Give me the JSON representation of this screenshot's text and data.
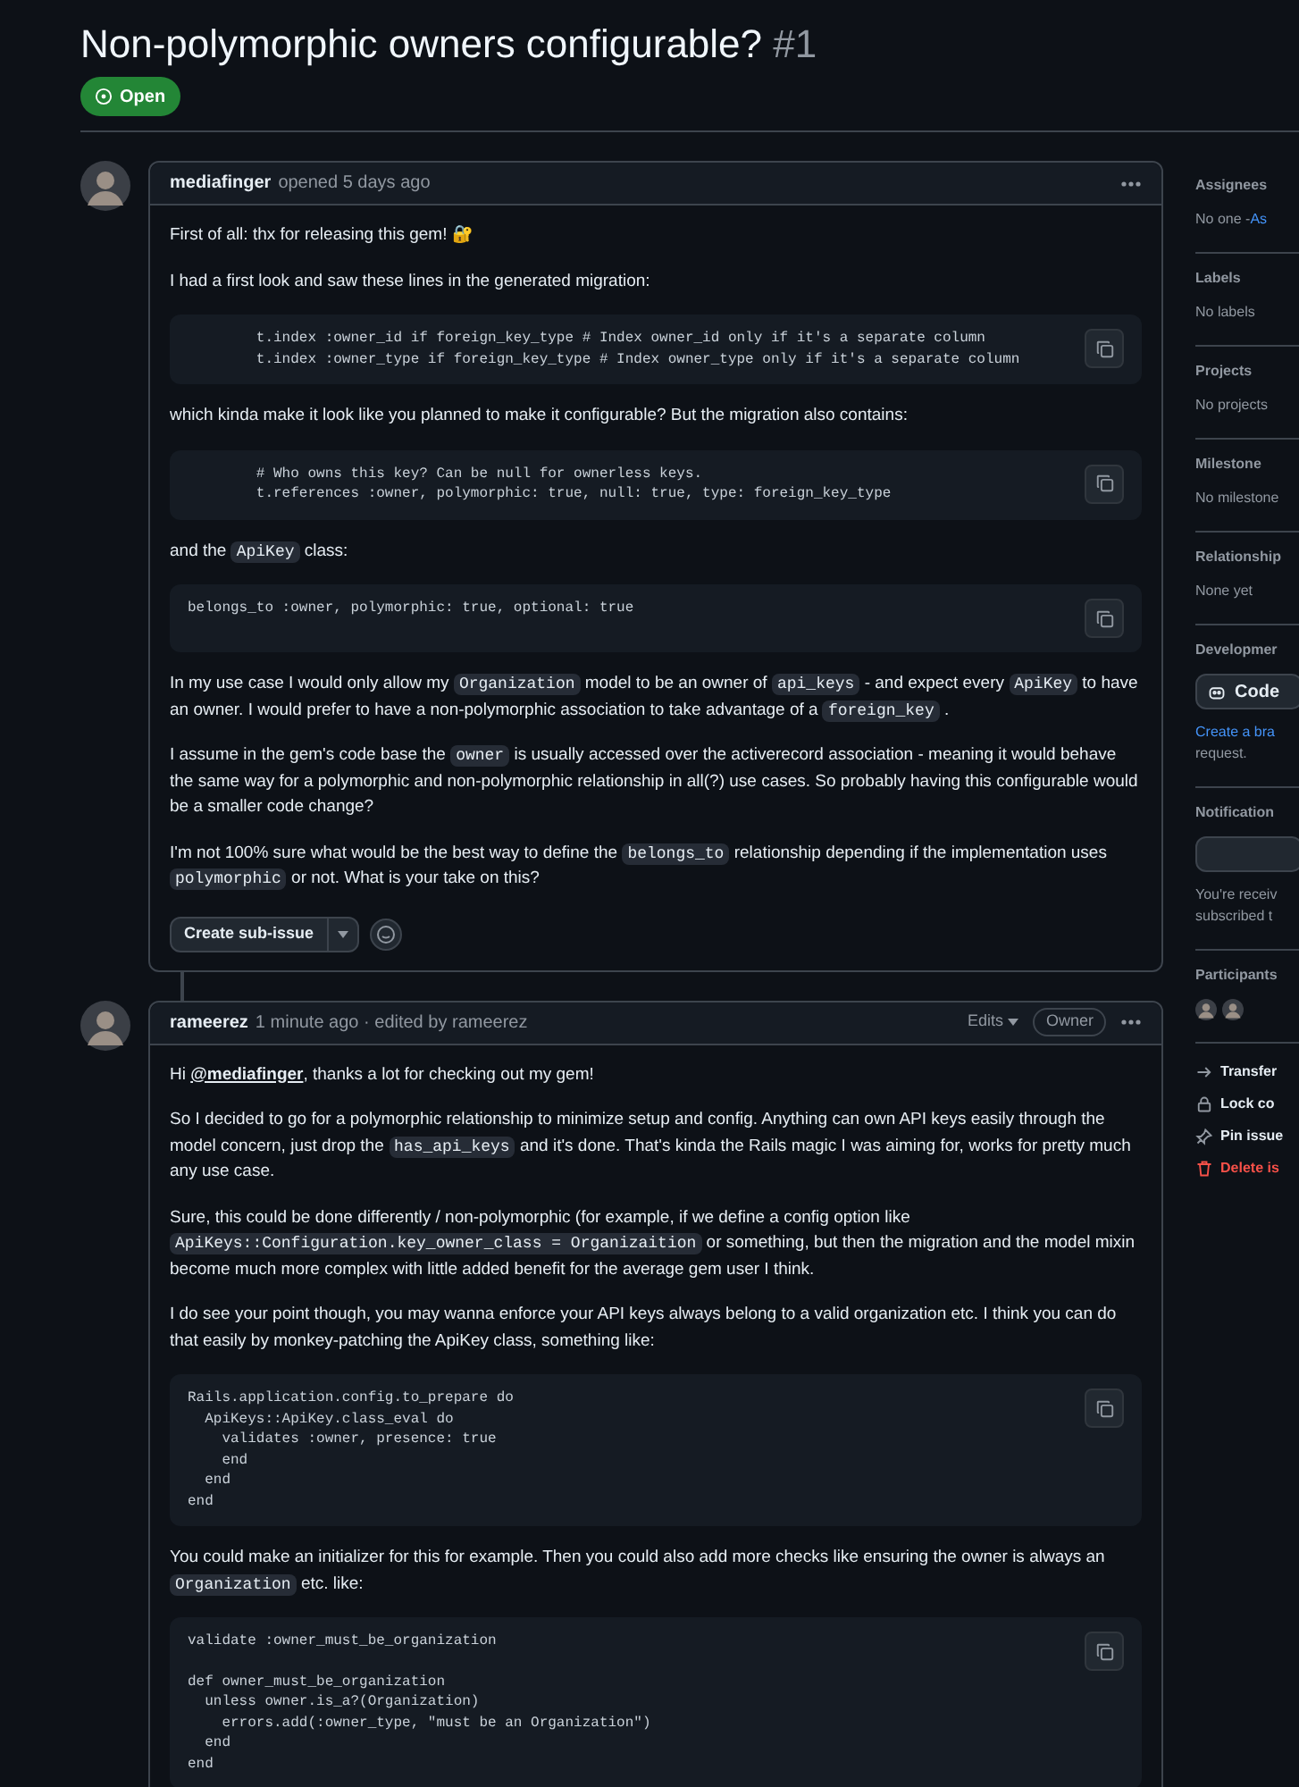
{
  "issue": {
    "title": "Non-polymorphic owners configurable?",
    "number": "#1",
    "state": {
      "kind": "open",
      "label": "Open"
    }
  },
  "comments": [
    {
      "author": "mediafinger",
      "meta": "opened 5 days ago",
      "blocks": [
        {
          "kind": "p",
          "parts": [
            {
              "kind": "text",
              "text": "First of all: thx for releasing this gem! 🔐"
            }
          ]
        },
        {
          "kind": "p",
          "parts": [
            {
              "kind": "text",
              "text": "I had a first look and saw these lines in the generated migration:"
            }
          ]
        },
        {
          "kind": "code",
          "lines": [
            "        t.index :owner_id if foreign_key_type # Index owner_id only if it's a separate column",
            "        t.index :owner_type if foreign_key_type # Index owner_type only if it's a separate column"
          ]
        },
        {
          "kind": "p",
          "parts": [
            {
              "kind": "text",
              "text": "which kinda make it look like you planned to make it configurable? But the migration also contains:"
            }
          ]
        },
        {
          "kind": "code",
          "lines": [
            "        # Who owns this key? Can be null for ownerless keys.",
            "        t.references :owner, polymorphic: true, null: true, type: foreign_key_type"
          ]
        },
        {
          "kind": "p",
          "parts": [
            {
              "kind": "text",
              "text": "and the "
            },
            {
              "kind": "code",
              "text": "ApiKey"
            },
            {
              "kind": "text",
              "text": " class:"
            }
          ]
        },
        {
          "kind": "code",
          "lines": [
            "belongs_to :owner, polymorphic: true, optional: true"
          ]
        },
        {
          "kind": "p",
          "parts": [
            {
              "kind": "text",
              "text": "In my use case I would only allow my "
            },
            {
              "kind": "code",
              "text": "Organization"
            },
            {
              "kind": "text",
              "text": " model to be an owner of "
            },
            {
              "kind": "code",
              "text": "api_keys"
            },
            {
              "kind": "text",
              "text": " - and expect every "
            },
            {
              "kind": "code",
              "text": "ApiKey"
            },
            {
              "kind": "text",
              "text": " to have an owner. I would prefer to have a non-polymorphic association to take advantage of a "
            },
            {
              "kind": "code",
              "text": "foreign_key"
            },
            {
              "kind": "text",
              "text": " ."
            }
          ]
        },
        {
          "kind": "p",
          "parts": [
            {
              "kind": "text",
              "text": "I assume in the gem's code base the "
            },
            {
              "kind": "code",
              "text": "owner"
            },
            {
              "kind": "text",
              "text": " is usually accessed over the activerecord association - meaning it would behave the same way for a polymorphic and non-polymorphic relationship in all(?) use cases. So probably having this configurable would be a smaller code change?"
            }
          ]
        },
        {
          "kind": "p",
          "parts": [
            {
              "kind": "text",
              "text": "I'm not 100% sure what would be the best way to define the "
            },
            {
              "kind": "code",
              "text": "belongs_to"
            },
            {
              "kind": "text",
              "text": " relationship depending if the implementation uses "
            },
            {
              "kind": "code",
              "text": "polymorphic"
            },
            {
              "kind": "text",
              "text": " or not. What is your take on this?"
            }
          ]
        }
      ],
      "action": "Create sub-issue"
    },
    {
      "author": "rameerez",
      "meta": "1 minute ago · edited by rameerez",
      "edits": "Edits",
      "role": "Owner",
      "blocks": [
        {
          "kind": "p",
          "parts": [
            {
              "kind": "text",
              "text": "Hi "
            },
            {
              "kind": "mention",
              "text": "@mediafinger"
            },
            {
              "kind": "text",
              "text": ", thanks a lot for checking out my gem!"
            }
          ]
        },
        {
          "kind": "p",
          "parts": [
            {
              "kind": "text",
              "text": "So I decided to go for a polymorphic relationship to minimize setup and config. Anything can own API keys easily through the model concern, just drop the "
            },
            {
              "kind": "code",
              "text": "has_api_keys"
            },
            {
              "kind": "text",
              "text": " and it's done. That's kinda the Rails magic I was aiming for, works for pretty much any use case."
            }
          ]
        },
        {
          "kind": "p",
          "parts": [
            {
              "kind": "text",
              "text": "Sure, this could be done differently / non-polymorphic (for example, if we define a config option like "
            },
            {
              "kind": "code",
              "text": "ApiKeys::Configuration.key_owner_class = Organizaition"
            },
            {
              "kind": "text",
              "text": " or something, but then the migration and the model mixin become much more complex with little added benefit for the average gem user I think."
            }
          ]
        },
        {
          "kind": "p",
          "parts": [
            {
              "kind": "text",
              "text": "I do see your point though, you may wanna enforce your API keys always belong to a valid organization etc. I think you can do that easily by monkey-patching the ApiKey class, something like:"
            }
          ]
        },
        {
          "kind": "code",
          "lines": [
            "Rails.application.config.to_prepare do",
            "  ApiKeys::ApiKey.class_eval do",
            "    validates :owner, presence: true",
            "    end",
            "  end",
            "end"
          ]
        },
        {
          "kind": "p",
          "parts": [
            {
              "kind": "text",
              "text": "You could make an initializer for this for example. Then you could also add more checks like ensuring the owner is always an "
            },
            {
              "kind": "code",
              "text": "Organization"
            },
            {
              "kind": "text",
              "text": " etc. like:"
            }
          ]
        },
        {
          "kind": "code",
          "lines": [
            "validate :owner_must_be_organization"
          ],
          "lines2": [
            "def owner_must_be_organization",
            "  unless owner.is_a?(Organization)",
            "    errors.add(:owner_type, \"must be an Organization\")",
            "  end",
            "end"
          ]
        }
      ]
    }
  ],
  "sidebar": {
    "sections": [
      {
        "kind": "assign",
        "heading": "Assignees",
        "text": "No one - ",
        "link": "As"
      },
      {
        "kind": "text",
        "heading": "Labels",
        "text": "No labels"
      },
      {
        "kind": "text",
        "heading": "Projects",
        "text": "No projects"
      },
      {
        "kind": "text",
        "heading": "Milestone",
        "text": "No milestone"
      },
      {
        "kind": "text",
        "heading": "Relationship",
        "text": "None yet"
      },
      {
        "kind": "dev",
        "heading": "Developmer",
        "button": "Code",
        "link": "Create a bra",
        "text": "request."
      },
      {
        "kind": "notify",
        "heading": "Notification",
        "text": "You're receiv",
        "text2": "subscribed t"
      },
      {
        "kind": "people",
        "heading": "Participants"
      }
    ],
    "actions": [
      {
        "kind": "transfer",
        "label": "Transfer",
        "danger": false
      },
      {
        "kind": "lock",
        "label": "Lock co",
        "danger": false
      },
      {
        "kind": "pin",
        "label": "Pin issue",
        "danger": false
      },
      {
        "kind": "delete",
        "label": "Delete is",
        "danger": true
      }
    ]
  }
}
